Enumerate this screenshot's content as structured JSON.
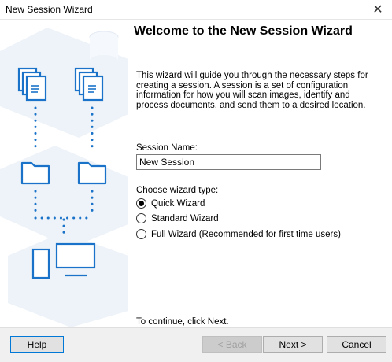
{
  "window": {
    "title": "New Session Wizard",
    "close_glyph": "✕"
  },
  "heading": "Welcome to the New Session Wizard",
  "intro": "This wizard will guide you through the necessary steps for creating a session. A session is a set of configuration information for how you will scan images, identify and process documents, and send them to a desired location.",
  "session": {
    "label": "Session Name:",
    "value": "New Session"
  },
  "wizard_type": {
    "label": "Choose wizard type:",
    "options": [
      {
        "label": "Quick Wizard",
        "selected": true
      },
      {
        "label": "Standard Wizard",
        "selected": false
      },
      {
        "label": "Full Wizard (Recommended for first time users)",
        "selected": false
      }
    ]
  },
  "continue_text": "To continue, click Next.",
  "buttons": {
    "help": "Help",
    "back": "< Back",
    "next": "Next >",
    "cancel": "Cancel"
  },
  "colors": {
    "accent": "#1a73c8",
    "art_bg": "#eaf1f8"
  }
}
